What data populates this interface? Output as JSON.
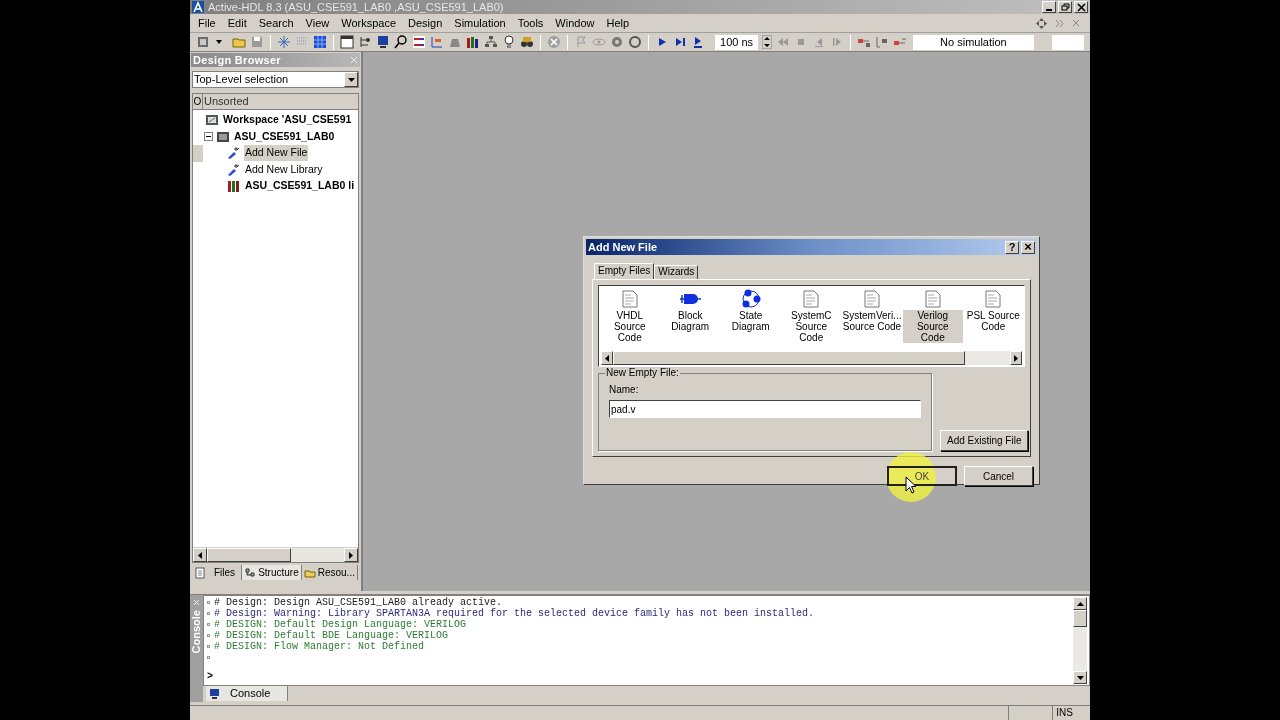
{
  "window": {
    "title": "Active-HDL 8.3 (ASU_CSE591_LAB0 ,ASU_CSE591_LAB0)"
  },
  "menu": [
    "File",
    "Edit",
    "Search",
    "View",
    "Workspace",
    "Design",
    "Simulation",
    "Tools",
    "Window",
    "Help"
  ],
  "toolbar": {
    "time_field": "100 ns",
    "status": "No simulation"
  },
  "design_browser": {
    "title": "Design Browser",
    "dropdown": "Top-Level selection",
    "column_marker": "O",
    "column": "Unsorted",
    "tree": [
      {
        "label": "Workspace 'ASU_CSE591",
        "kind": "workspace",
        "selected": false,
        "children": [
          {
            "label": "ASU_CSE591_LAB0",
            "kind": "design",
            "selected": false,
            "expanded": true,
            "children": [
              {
                "label": "Add New File",
                "kind": "action",
                "selected": true
              },
              {
                "label": "Add New Library",
                "kind": "action",
                "selected": false
              },
              {
                "label": "ASU_CSE591_LAB0 li",
                "kind": "library",
                "selected": false
              }
            ]
          }
        ]
      }
    ],
    "tabs": [
      {
        "label": "Files",
        "selected": false
      },
      {
        "label": "Structure",
        "selected": true
      },
      {
        "label": "Resou...",
        "selected": false
      }
    ]
  },
  "dialog": {
    "title": "Add New File",
    "help": "?",
    "close": "×",
    "tabs": [
      {
        "label": "Empty Files",
        "selected": true
      },
      {
        "label": "Wizards",
        "selected": false
      }
    ],
    "items": [
      {
        "label": "VHDL Source\nCode",
        "kind": "document",
        "selected": false
      },
      {
        "label": "Block\nDiagram",
        "kind": "block",
        "selected": false
      },
      {
        "label": "State\nDiagram",
        "kind": "state",
        "selected": false
      },
      {
        "label": "SystemC\nSource Code",
        "kind": "document",
        "selected": false
      },
      {
        "label": "SystemVeri...\nSource Code",
        "kind": "document",
        "selected": false
      },
      {
        "label": "Verilog\nSource Code",
        "kind": "document",
        "selected": true
      },
      {
        "label": "PSL Source\nCode",
        "kind": "document",
        "selected": false
      }
    ],
    "group_label": "New Empty File:",
    "name_label": "Name:",
    "name_value": "pad.v",
    "add_existing": "Add Existing File",
    "ok": "OK",
    "cancel": "Cancel"
  },
  "console": {
    "side_label": "Console",
    "lines": [
      {
        "text": "# Design: Design ASU_CSE591_LAB0 already active.",
        "color": "#202020"
      },
      {
        "text": "# Design: Warning: Library SPARTAN3A required for the selected device family has not been installed.",
        "color": "#2a2a7a"
      },
      {
        "text": "# DESIGN: Default Design Language: VERILOG",
        "color": "#2e7d32"
      },
      {
        "text": "# DESIGN: Default BDE Language: VERILOG",
        "color": "#2e7d32"
      },
      {
        "text": "# DESIGN: Flow Manager: Not Defined",
        "color": "#2e7d32"
      }
    ],
    "prompt": ">",
    "tab": "Console"
  },
  "status_bar": {
    "mode": "INS"
  }
}
